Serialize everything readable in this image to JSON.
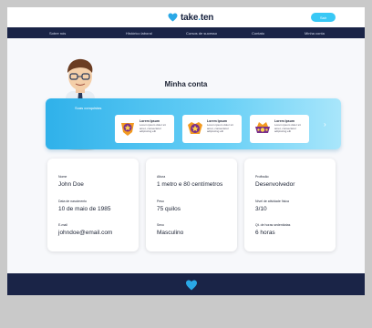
{
  "brand": {
    "name": "take",
    "dot": ".",
    "suffix": "ten"
  },
  "header": {
    "button_label": "Sair"
  },
  "nav": {
    "items": [
      "Sobre nós",
      "Histórico laboral",
      "Cursos de sucesso",
      "Contato",
      "Minha conta"
    ]
  },
  "page": {
    "title": "Minha conta"
  },
  "achievements": {
    "title": "Suas conquistas",
    "items": [
      {
        "title": "Lorem Ipsum",
        "text": "Lorem ipsum dolor sit amet, consectetur adipiscing elit"
      },
      {
        "title": "Lorem Ipsum",
        "text": "Lorem ipsum dolor sit amet, consectetur adipiscing elit"
      },
      {
        "title": "Lorem Ipsum",
        "text": "Lorem ipsum dolor sit amet, consectetur adipiscing elit"
      }
    ],
    "next_icon": "chevron-right-icon"
  },
  "profile": {
    "col1": [
      {
        "label": "Nome",
        "value": "John Doe"
      },
      {
        "label": "Data de nascimento",
        "value": "10 de maio de 1985"
      },
      {
        "label": "E-mail",
        "value": "johndoe@email.com"
      }
    ],
    "col2": [
      {
        "label": "Altura",
        "value": "1 metro e 80 centímetros"
      },
      {
        "label": "Peso",
        "value": "75 quilos"
      },
      {
        "label": "Sexo",
        "value": "Masculino"
      }
    ],
    "col3": [
      {
        "label": "Profissão",
        "value": "Desenvolvedor"
      },
      {
        "label": "Nível de atividade física",
        "value": "3/10"
      },
      {
        "label": "Qt. de horas sedentárias",
        "value": "6 horas"
      }
    ]
  },
  "colors": {
    "accent": "#38c8f5",
    "navy": "#1a2447",
    "banner": "#2fb1ea"
  }
}
